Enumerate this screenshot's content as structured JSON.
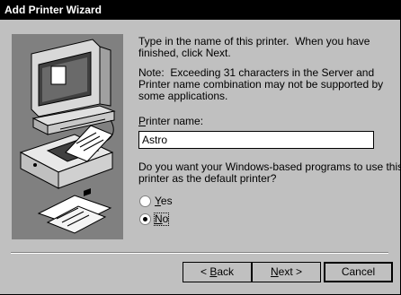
{
  "window": {
    "title": "Add Printer Wizard"
  },
  "instructions": {
    "line1": "Type in the name of this printer.  When you have",
    "line2": "finished, click Next.",
    "note1": "Note:  Exceeding 31 characters in the Server and",
    "note2": "Printer name combination may not be supported by",
    "note3": "some applications."
  },
  "printer_name": {
    "label_underlined": "P",
    "label_rest": "rinter name:",
    "value": "Astro"
  },
  "default_question": {
    "line1": "Do you want your Windows-based programs to use this",
    "line2": "printer as the default printer?"
  },
  "options": {
    "yes_underlined": "Y",
    "yes_rest": "es",
    "no_underlined": "N",
    "no_rest": "o",
    "selected": "No"
  },
  "buttons": {
    "back_prefix": "< ",
    "back_underlined": "B",
    "back_rest": "ack",
    "next_underlined": "N",
    "next_rest": "ext >",
    "cancel": "Cancel"
  }
}
